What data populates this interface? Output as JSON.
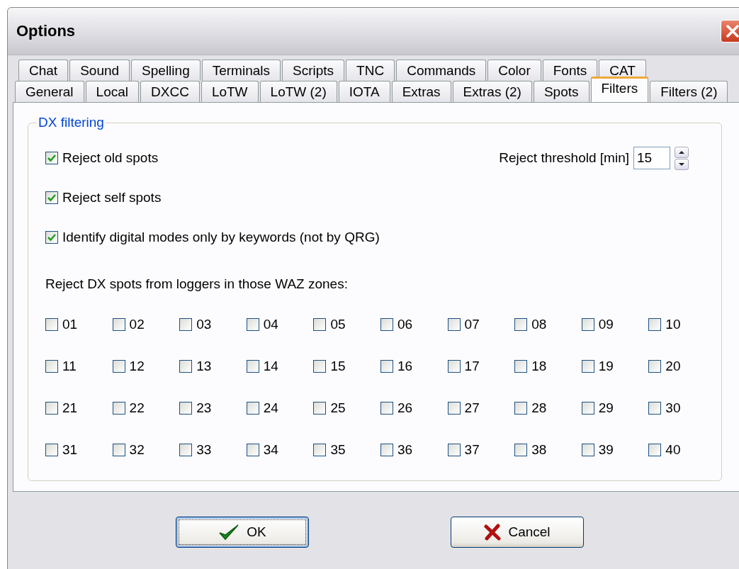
{
  "window": {
    "title": "Options"
  },
  "tab_rows": [
    [
      {
        "label": "Chat",
        "selected": false
      },
      {
        "label": "Sound",
        "selected": false
      },
      {
        "label": "Spelling",
        "selected": false
      },
      {
        "label": "Terminals",
        "selected": false
      },
      {
        "label": "Scripts",
        "selected": false
      },
      {
        "label": "TNC",
        "selected": false
      },
      {
        "label": "Commands",
        "selected": false
      },
      {
        "label": "Color",
        "selected": false
      },
      {
        "label": "Fonts",
        "selected": false
      },
      {
        "label": "CAT",
        "selected": false
      }
    ],
    [
      {
        "label": "General",
        "selected": false
      },
      {
        "label": "Local",
        "selected": false
      },
      {
        "label": "DXCC",
        "selected": false
      },
      {
        "label": "LoTW",
        "selected": false
      },
      {
        "label": "LoTW (2)",
        "selected": false
      },
      {
        "label": "IOTA",
        "selected": false
      },
      {
        "label": "Extras",
        "selected": false
      },
      {
        "label": "Extras (2)",
        "selected": false
      },
      {
        "label": "Spots",
        "selected": false
      },
      {
        "label": "Filters",
        "selected": true
      },
      {
        "label": "Filters (2)",
        "selected": false
      }
    ]
  ],
  "group": {
    "legend": "DX filtering",
    "options": [
      {
        "label": "Reject old spots",
        "checked": true
      },
      {
        "label": "Reject self spots",
        "checked": true
      },
      {
        "label": "Identify digital modes only by keywords (not by QRG)",
        "checked": true
      }
    ],
    "threshold": {
      "label": "Reject threshold [min]",
      "value": "15"
    },
    "zones_label": "Reject DX spots from loggers in those WAZ zones:",
    "zones": [
      {
        "label": "01",
        "checked": false
      },
      {
        "label": "02",
        "checked": false
      },
      {
        "label": "03",
        "checked": false
      },
      {
        "label": "04",
        "checked": false
      },
      {
        "label": "05",
        "checked": false
      },
      {
        "label": "06",
        "checked": false
      },
      {
        "label": "07",
        "checked": false
      },
      {
        "label": "08",
        "checked": false
      },
      {
        "label": "09",
        "checked": false
      },
      {
        "label": "10",
        "checked": false
      },
      {
        "label": "11",
        "checked": false
      },
      {
        "label": "12",
        "checked": false
      },
      {
        "label": "13",
        "checked": false
      },
      {
        "label": "14",
        "checked": false
      },
      {
        "label": "15",
        "checked": false
      },
      {
        "label": "16",
        "checked": false
      },
      {
        "label": "17",
        "checked": false
      },
      {
        "label": "18",
        "checked": false
      },
      {
        "label": "19",
        "checked": false
      },
      {
        "label": "20",
        "checked": false
      },
      {
        "label": "21",
        "checked": false
      },
      {
        "label": "22",
        "checked": false
      },
      {
        "label": "23",
        "checked": false
      },
      {
        "label": "24",
        "checked": false
      },
      {
        "label": "25",
        "checked": false
      },
      {
        "label": "26",
        "checked": false
      },
      {
        "label": "27",
        "checked": false
      },
      {
        "label": "28",
        "checked": false
      },
      {
        "label": "29",
        "checked": false
      },
      {
        "label": "30",
        "checked": false
      },
      {
        "label": "31",
        "checked": false
      },
      {
        "label": "32",
        "checked": false
      },
      {
        "label": "33",
        "checked": false
      },
      {
        "label": "34",
        "checked": false
      },
      {
        "label": "35",
        "checked": false
      },
      {
        "label": "36",
        "checked": false
      },
      {
        "label": "37",
        "checked": false
      },
      {
        "label": "38",
        "checked": false
      },
      {
        "label": "39",
        "checked": false
      },
      {
        "label": "40",
        "checked": false
      }
    ]
  },
  "buttons": [
    {
      "label": "OK",
      "kind": "ok",
      "focused": true
    },
    {
      "label": "Cancel",
      "kind": "cancel",
      "focused": false
    }
  ]
}
